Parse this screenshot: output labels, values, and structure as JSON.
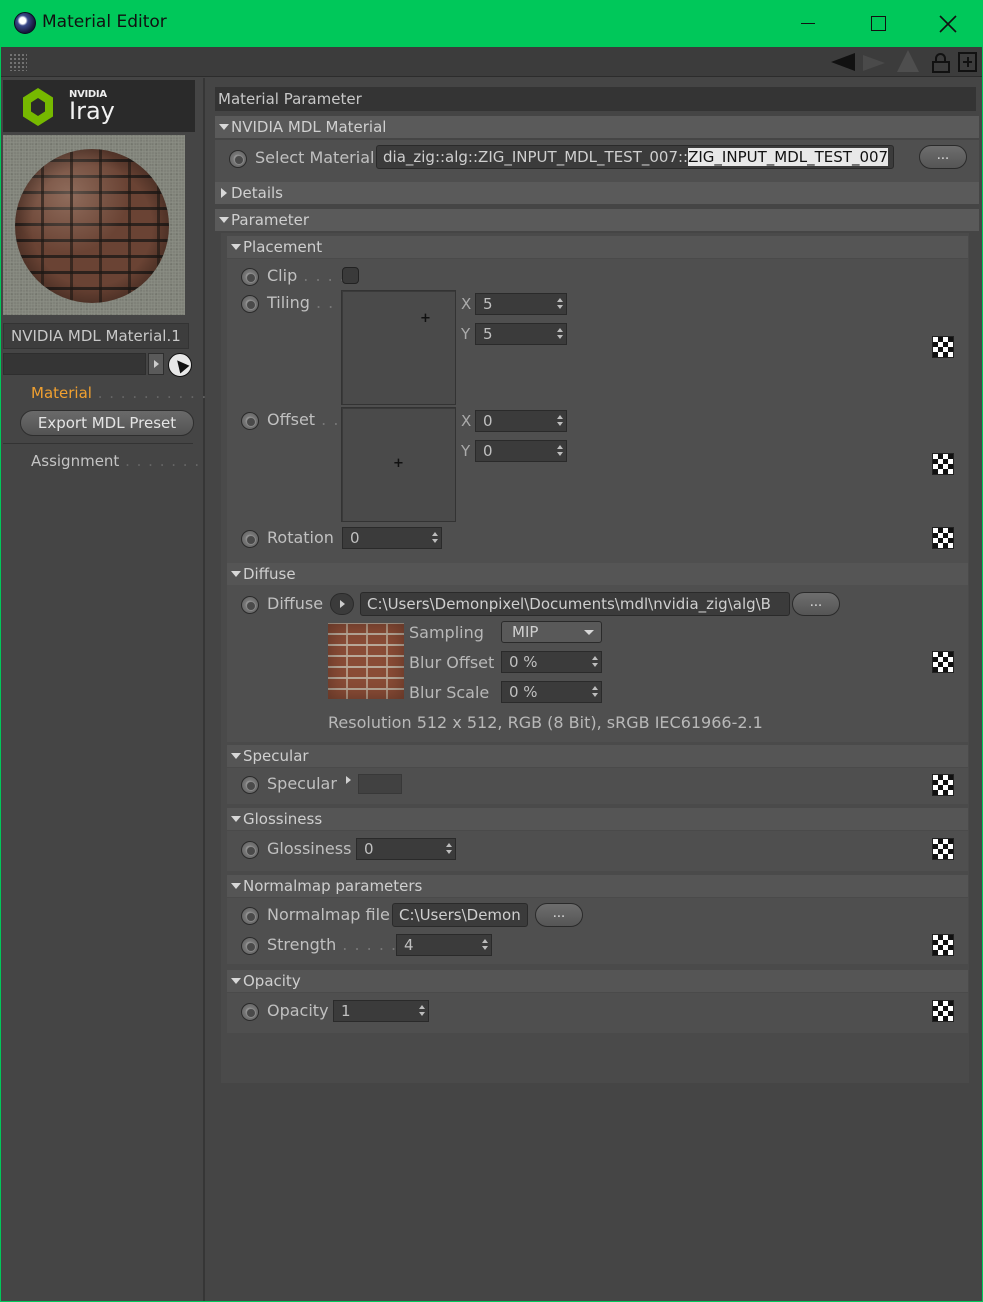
{
  "window": {
    "title": "Material Editor",
    "minimize_icon": "minimize-icon",
    "maximize_icon": "maximize-icon",
    "close_icon": "close-icon"
  },
  "sidebar": {
    "logo_brand": "NVIDIA",
    "logo_product": "Iray",
    "material_name": "NVIDIA MDL Material.1",
    "nav_material": "Material",
    "nav_material_dots": " . . . . . . . . . .",
    "export_button": "Export MDL Preset",
    "nav_assignment": "Assignment",
    "nav_assignment_dots": " . . . . . . .",
    "accent_color": "#f0a030"
  },
  "panel": {
    "title": "Material Parameter",
    "mdl_section": "NVIDIA MDL Material",
    "select_material_label": "Select Material",
    "select_material_prefix": "dia_zig::alg::ZIG_INPUT_MDL_TEST_007::",
    "select_material_highlight": "ZIG_INPUT_MDL_TEST_007",
    "select_button": "...",
    "details_section": "Details",
    "parameter_section": "Parameter"
  },
  "placement": {
    "title": "Placement",
    "clip_label": "Clip",
    "clip_dots": " . . . .",
    "tiling_label": "Tiling",
    "tiling_dots": " . .",
    "tiling_x": "5",
    "tiling_y": "5",
    "offset_label": "Offset",
    "offset_dots": " . .",
    "offset_x": "0",
    "offset_y": "0",
    "axis_x": "X",
    "axis_y": "Y",
    "cross": "+",
    "rotation_label": "Rotation",
    "rotation_value": "0"
  },
  "diffuse": {
    "title": "Diffuse",
    "label": "Diffuse",
    "path": "C:\\Users\\Demonpixel\\Documents\\mdl\\nvidia_zig\\alg\\B",
    "browse_button": "...",
    "sampling_label": "Sampling",
    "sampling_value": "MIP",
    "blur_offset_label": "Blur Offset",
    "blur_offset_value": "0 %",
    "blur_scale_label": "Blur Scale",
    "blur_scale_value": "0 %",
    "resolution": "Resolution 512 x 512, RGB (8 Bit), sRGB IEC61966-2.1"
  },
  "specular": {
    "title": "Specular",
    "label": "Specular"
  },
  "glossiness": {
    "title": "Glossiness",
    "label": "Glossiness",
    "value": "0"
  },
  "normalmap": {
    "title": "Normalmap parameters",
    "file_label": "Normalmap file",
    "file_path": "C:\\Users\\Demon",
    "browse_button": "...",
    "strength_label": "Strength",
    "strength_dots": " . . . . . .",
    "strength_value": "4"
  },
  "opacity": {
    "title": "Opacity",
    "label": "Opacity",
    "value": "1"
  }
}
